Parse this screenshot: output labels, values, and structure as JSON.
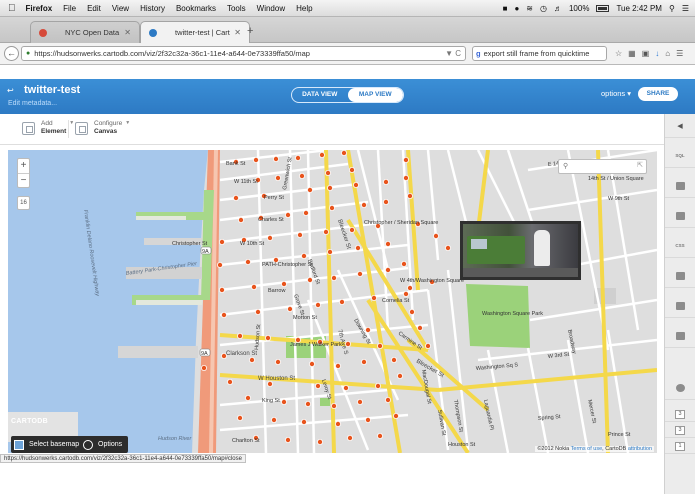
{
  "menubar": {
    "app": "Firefox",
    "items": [
      "File",
      "Edit",
      "View",
      "History",
      "Bookmarks",
      "Tools",
      "Window",
      "Help"
    ],
    "battery": "100%",
    "clock": "Tue 2:42 PM"
  },
  "browser": {
    "tabs": [
      {
        "label": "NYC Open Data"
      },
      {
        "label": "twitter-test | CartoDB"
      }
    ],
    "url": "https://hudsonwerks.cartodb.com/viz/2f32c32a-36c1-11e4-a644-0e73339ffa50/map",
    "search_value": "export still frame from quicktime",
    "status_url": "https://hudsonwerks.cartodb.com/viz/2f32c32a-36c1-11e4-a644-0e73339ffa50/map#close"
  },
  "header": {
    "title": "twitter-test",
    "subtitle": "Edit metadata...",
    "view_toggle": [
      "DATA VIEW",
      "MAP VIEW"
    ],
    "options_label": "options",
    "share_label": "SHARE"
  },
  "toolbar": {
    "add_top": "Add",
    "add_bottom": "Element",
    "configure_top": "Configure",
    "configure_bottom": "Canvas"
  },
  "map": {
    "zoom_in": "+",
    "zoom_out": "−",
    "zoom_level": "16",
    "watermark": "CARTODB",
    "basemap_button": "Select basemap",
    "options_button": "Options",
    "attribution_prefix": "©2012 Nokia",
    "attribution_terms": "Terms of use",
    "attribution_sep": ", CartoDB",
    "attribution_link": "attribution",
    "street_labels": [
      "Bank St",
      "W 11th St",
      "Perry St",
      "Charles St",
      "W 10th St",
      "Christopher St",
      "PATH-Christopher St",
      "Barrow",
      "Morton St",
      "Clarkson St",
      "W Houston St",
      "King St",
      "Bleecker St",
      "7th Ave S",
      "Greenwich St",
      "Hudson St",
      "Christopher / Sheridan Square",
      "W 4th/Washington Square",
      "Washington Square Park",
      "Washington Sq S",
      "Bleecker St",
      "E 14th St",
      "14th St / Union Square",
      "W 9th St",
      "Broadway",
      "W 3rd St",
      "Bedford St",
      "Carmine St",
      "Cornelia St",
      "James J Walker Park",
      "Grove St",
      "Downing St",
      "Leroy St",
      "Houston St",
      "Laguardia Pl",
      "Mercer St",
      "Thompson St",
      "Sullivan St",
      "MacDougal St",
      "Charlton St",
      "Prince St",
      "Spring St"
    ],
    "water_labels": [
      "Hudson River",
      "Battery Park-Christopher Pier",
      "Franklin Delano Roosevelt Highway"
    ],
    "route_shields": [
      "9A",
      "9A"
    ]
  },
  "sidebar_right": {
    "labels": [
      "SQL",
      "CSS"
    ],
    "counters": [
      "3",
      "3",
      "1"
    ]
  },
  "colors": {
    "accent": "#2d7ac4",
    "map_points": "#e8541d",
    "water": "#a6c7eb",
    "park": "#9bd27a",
    "highway": "#f2d53c"
  }
}
